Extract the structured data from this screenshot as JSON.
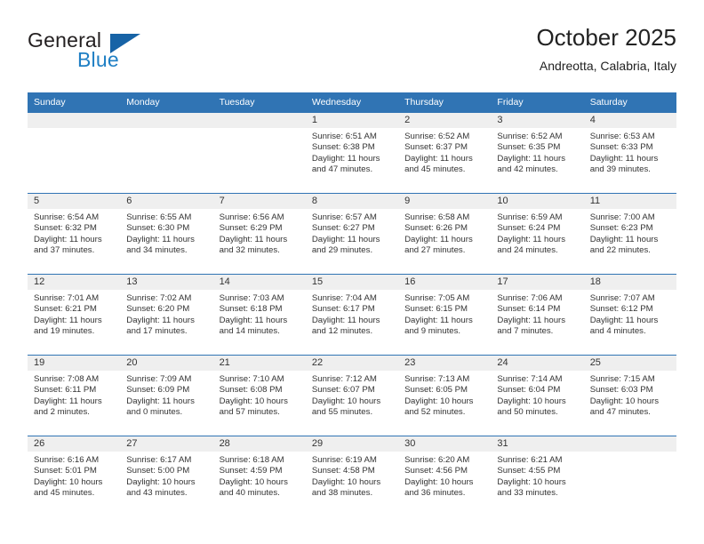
{
  "brand": {
    "name_part1": "General",
    "name_part2": "Blue",
    "logo_icon": "blue-triangle-logo"
  },
  "header": {
    "title": "October 2025",
    "subtitle": "Andreotta, Calabria, Italy"
  },
  "colors": {
    "header_blue": "#3074b4",
    "brand_blue": "#1f7fc4",
    "logo_triangle": "#1763a6",
    "daynum_band": "#efefef",
    "text": "#333333",
    "page_background": "#ffffff"
  },
  "weekday_headers": [
    "Sunday",
    "Monday",
    "Tuesday",
    "Wednesday",
    "Thursday",
    "Friday",
    "Saturday"
  ],
  "labels": {
    "sunrise_prefix": "Sunrise:",
    "sunset_prefix": "Sunset:",
    "daylight_prefix": "Daylight:"
  },
  "weeks": [
    [
      {
        "day": "",
        "empty": true
      },
      {
        "day": "",
        "empty": true
      },
      {
        "day": "",
        "empty": true
      },
      {
        "day": "1",
        "sunrise": "Sunrise: 6:51 AM",
        "sunset": "Sunset: 6:38 PM",
        "daylight": "Daylight: 11 hours and 47 minutes."
      },
      {
        "day": "2",
        "sunrise": "Sunrise: 6:52 AM",
        "sunset": "Sunset: 6:37 PM",
        "daylight": "Daylight: 11 hours and 45 minutes."
      },
      {
        "day": "3",
        "sunrise": "Sunrise: 6:52 AM",
        "sunset": "Sunset: 6:35 PM",
        "daylight": "Daylight: 11 hours and 42 minutes."
      },
      {
        "day": "4",
        "sunrise": "Sunrise: 6:53 AM",
        "sunset": "Sunset: 6:33 PM",
        "daylight": "Daylight: 11 hours and 39 minutes."
      }
    ],
    [
      {
        "day": "5",
        "sunrise": "Sunrise: 6:54 AM",
        "sunset": "Sunset: 6:32 PM",
        "daylight": "Daylight: 11 hours and 37 minutes."
      },
      {
        "day": "6",
        "sunrise": "Sunrise: 6:55 AM",
        "sunset": "Sunset: 6:30 PM",
        "daylight": "Daylight: 11 hours and 34 minutes."
      },
      {
        "day": "7",
        "sunrise": "Sunrise: 6:56 AM",
        "sunset": "Sunset: 6:29 PM",
        "daylight": "Daylight: 11 hours and 32 minutes."
      },
      {
        "day": "8",
        "sunrise": "Sunrise: 6:57 AM",
        "sunset": "Sunset: 6:27 PM",
        "daylight": "Daylight: 11 hours and 29 minutes."
      },
      {
        "day": "9",
        "sunrise": "Sunrise: 6:58 AM",
        "sunset": "Sunset: 6:26 PM",
        "daylight": "Daylight: 11 hours and 27 minutes."
      },
      {
        "day": "10",
        "sunrise": "Sunrise: 6:59 AM",
        "sunset": "Sunset: 6:24 PM",
        "daylight": "Daylight: 11 hours and 24 minutes."
      },
      {
        "day": "11",
        "sunrise": "Sunrise: 7:00 AM",
        "sunset": "Sunset: 6:23 PM",
        "daylight": "Daylight: 11 hours and 22 minutes."
      }
    ],
    [
      {
        "day": "12",
        "sunrise": "Sunrise: 7:01 AM",
        "sunset": "Sunset: 6:21 PM",
        "daylight": "Daylight: 11 hours and 19 minutes."
      },
      {
        "day": "13",
        "sunrise": "Sunrise: 7:02 AM",
        "sunset": "Sunset: 6:20 PM",
        "daylight": "Daylight: 11 hours and 17 minutes."
      },
      {
        "day": "14",
        "sunrise": "Sunrise: 7:03 AM",
        "sunset": "Sunset: 6:18 PM",
        "daylight": "Daylight: 11 hours and 14 minutes."
      },
      {
        "day": "15",
        "sunrise": "Sunrise: 7:04 AM",
        "sunset": "Sunset: 6:17 PM",
        "daylight": "Daylight: 11 hours and 12 minutes."
      },
      {
        "day": "16",
        "sunrise": "Sunrise: 7:05 AM",
        "sunset": "Sunset: 6:15 PM",
        "daylight": "Daylight: 11 hours and 9 minutes."
      },
      {
        "day": "17",
        "sunrise": "Sunrise: 7:06 AM",
        "sunset": "Sunset: 6:14 PM",
        "daylight": "Daylight: 11 hours and 7 minutes."
      },
      {
        "day": "18",
        "sunrise": "Sunrise: 7:07 AM",
        "sunset": "Sunset: 6:12 PM",
        "daylight": "Daylight: 11 hours and 4 minutes."
      }
    ],
    [
      {
        "day": "19",
        "sunrise": "Sunrise: 7:08 AM",
        "sunset": "Sunset: 6:11 PM",
        "daylight": "Daylight: 11 hours and 2 minutes."
      },
      {
        "day": "20",
        "sunrise": "Sunrise: 7:09 AM",
        "sunset": "Sunset: 6:09 PM",
        "daylight": "Daylight: 11 hours and 0 minutes."
      },
      {
        "day": "21",
        "sunrise": "Sunrise: 7:10 AM",
        "sunset": "Sunset: 6:08 PM",
        "daylight": "Daylight: 10 hours and 57 minutes."
      },
      {
        "day": "22",
        "sunrise": "Sunrise: 7:12 AM",
        "sunset": "Sunset: 6:07 PM",
        "daylight": "Daylight: 10 hours and 55 minutes."
      },
      {
        "day": "23",
        "sunrise": "Sunrise: 7:13 AM",
        "sunset": "Sunset: 6:05 PM",
        "daylight": "Daylight: 10 hours and 52 minutes."
      },
      {
        "day": "24",
        "sunrise": "Sunrise: 7:14 AM",
        "sunset": "Sunset: 6:04 PM",
        "daylight": "Daylight: 10 hours and 50 minutes."
      },
      {
        "day": "25",
        "sunrise": "Sunrise: 7:15 AM",
        "sunset": "Sunset: 6:03 PM",
        "daylight": "Daylight: 10 hours and 47 minutes."
      }
    ],
    [
      {
        "day": "26",
        "sunrise": "Sunrise: 6:16 AM",
        "sunset": "Sunset: 5:01 PM",
        "daylight": "Daylight: 10 hours and 45 minutes."
      },
      {
        "day": "27",
        "sunrise": "Sunrise: 6:17 AM",
        "sunset": "Sunset: 5:00 PM",
        "daylight": "Daylight: 10 hours and 43 minutes."
      },
      {
        "day": "28",
        "sunrise": "Sunrise: 6:18 AM",
        "sunset": "Sunset: 4:59 PM",
        "daylight": "Daylight: 10 hours and 40 minutes."
      },
      {
        "day": "29",
        "sunrise": "Sunrise: 6:19 AM",
        "sunset": "Sunset: 4:58 PM",
        "daylight": "Daylight: 10 hours and 38 minutes."
      },
      {
        "day": "30",
        "sunrise": "Sunrise: 6:20 AM",
        "sunset": "Sunset: 4:56 PM",
        "daylight": "Daylight: 10 hours and 36 minutes."
      },
      {
        "day": "31",
        "sunrise": "Sunrise: 6:21 AM",
        "sunset": "Sunset: 4:55 PM",
        "daylight": "Daylight: 10 hours and 33 minutes."
      },
      {
        "day": "",
        "empty": true
      }
    ]
  ]
}
